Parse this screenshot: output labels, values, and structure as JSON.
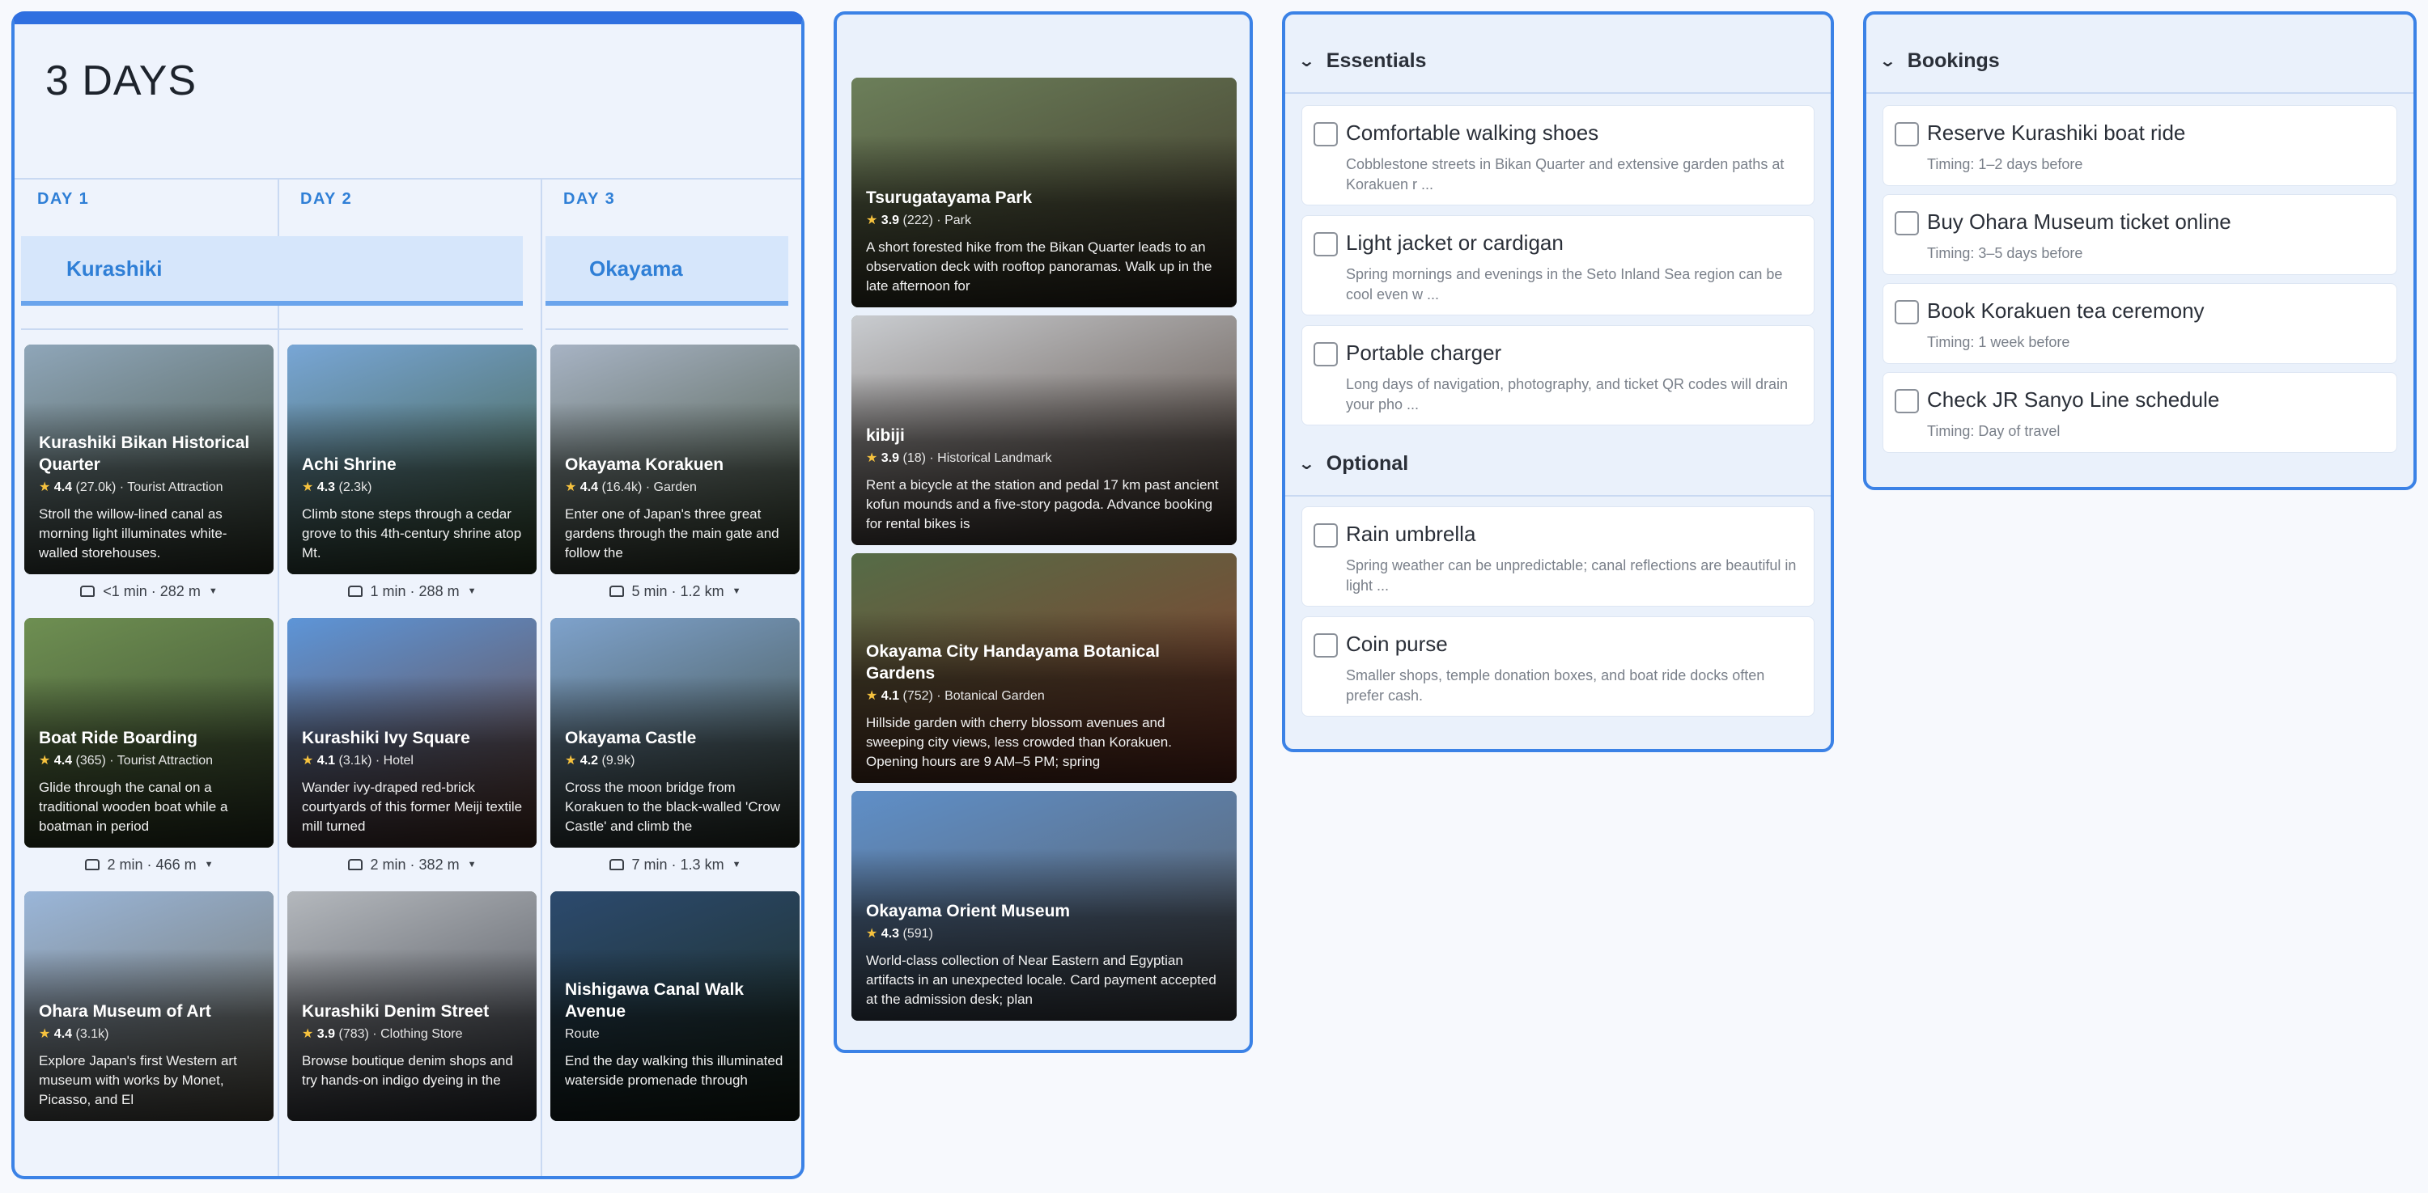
{
  "itinerary": {
    "title": "3 DAYS",
    "days": [
      {
        "label": "DAY 1",
        "base": "Kurashiki"
      },
      {
        "label": "DAY 2",
        "base": ""
      },
      {
        "label": "DAY 3",
        "base": "Okayama"
      }
    ],
    "cards": [
      {
        "name": "Kurashiki Bikan Historical Quarter",
        "rating": "4.4",
        "reviews": "(27.0k)",
        "category": "Tourist Attraction",
        "desc": "Stroll the willow-lined canal as morning light illuminates white-walled storehouses.",
        "c1": "#8fa6b9",
        "c2": "#3f4a38"
      },
      {
        "name": "Achi Shrine",
        "rating": "4.3",
        "reviews": "(2.3k)",
        "category": "",
        "desc": "Climb stone steps through a cedar grove to this 4th-century shrine atop Mt.",
        "c1": "#78a6d6",
        "c2": "#3c5530"
      },
      {
        "name": "Okayama Korakuen",
        "rating": "4.4",
        "reviews": "(16.4k)",
        "category": "Garden",
        "desc": "Enter one of Japan's three great gardens through the main gate and follow the",
        "c1": "#a7b3c4",
        "c2": "#3d4a32"
      },
      {
        "name": "Boat Ride Boarding",
        "rating": "4.4",
        "reviews": "(365)",
        "category": "Tourist Attraction",
        "desc": "Glide through the canal on a traditional wooden boat while a boatman in period",
        "c1": "#6e8f52",
        "c2": "#37452d"
      },
      {
        "name": "Kurashiki Ivy Square",
        "rating": "4.1",
        "reviews": "(3.1k)",
        "category": "Hotel",
        "desc": "Wander ivy-draped red-brick courtyards of this former Meiji textile mill turned",
        "c1": "#5d95d8",
        "c2": "#6b3f30"
      },
      {
        "name": "Okayama Castle",
        "rating": "4.2",
        "reviews": "(9.9k)",
        "category": "",
        "desc": "Cross the moon bridge from Korakuen to the black-walled 'Crow Castle' and climb the",
        "c1": "#7ea2cc",
        "c2": "#3a4436"
      },
      {
        "name": "Ohara Museum of Art",
        "rating": "4.4",
        "reviews": "(3.1k)",
        "category": "",
        "desc": "Explore Japan's first Western art museum with works by Monet, Picasso, and El",
        "c1": "#9ab6d9",
        "c2": "#6f6a5a"
      },
      {
        "name": "Kurashiki Denim Street",
        "rating": "3.9",
        "reviews": "(783)",
        "category": "Clothing Store",
        "desc": "Browse boutique denim shops and try hands-on indigo dyeing in the",
        "c1": "#b4b8bd",
        "c2": "#3d4048"
      },
      {
        "name": "Nishigawa Canal Walk Avenue",
        "rating": "",
        "reviews": "",
        "category": "Route",
        "desc": "End the day walking this illuminated waterside promenade through",
        "c1": "#2c4a6e",
        "c2": "#1b2a1c"
      }
    ],
    "travels": [
      {
        "text": "<1 min · 282 m"
      },
      {
        "text": "1 min · 288 m"
      },
      {
        "text": "5 min · 1.2 km"
      },
      {
        "text": "2 min · 466 m"
      },
      {
        "text": "2 min · 382 m"
      },
      {
        "text": "7 min · 1.3 km"
      }
    ]
  },
  "suggestions": [
    {
      "name": "Tsurugatayama Park",
      "rating": "3.9",
      "reviews": "(222)",
      "category": "Park",
      "desc": "A short forested hike from the Bikan Quarter leads to an observation deck with rooftop panoramas. Walk up in the late afternoon for",
      "c1": "#6c7f5a",
      "c2": "#3b3226"
    },
    {
      "name": "kibiji",
      "rating": "3.9",
      "reviews": "(18)",
      "category": "Historical Landmark",
      "desc": "Rent a bicycle at the station and pedal 17 km past ancient kofun mounds and a five-story pagoda. Advance booking for rental bikes is",
      "c1": "#c9ccd0",
      "c2": "#4a3a30"
    },
    {
      "name": "Okayama City Handayama Botanical Gardens",
      "rating": "4.1",
      "reviews": "(752)",
      "category": "Botanical Garden",
      "desc": "Hillside garden with cherry blossom avenues and sweeping city views, less crowded than Korakuen. Opening hours are 9 AM–5 PM; spring",
      "c1": "#556c47",
      "c2": "#8a3a2a"
    },
    {
      "name": "Okayama Orient Museum",
      "rating": "4.3",
      "reviews": "(591)",
      "category": "",
      "desc": "World-class collection of Near Eastern and Egyptian artifacts in an unexpected locale. Card payment accepted at the admission desk; plan",
      "c1": "#5f8fc8",
      "c2": "#5a5b5e"
    }
  ],
  "packing": {
    "sections": [
      {
        "title": "Essentials",
        "items": [
          {
            "title": "Comfortable walking shoes",
            "note": "Cobblestone streets in Bikan Quarter and extensive garden paths at Korakuen r ..."
          },
          {
            "title": "Light jacket or cardigan",
            "note": "Spring mornings and evenings in the Seto Inland Sea region can be cool even w ..."
          },
          {
            "title": "Portable charger",
            "note": "Long days of navigation, photography, and ticket QR codes will drain your pho ..."
          }
        ]
      },
      {
        "title": "Optional",
        "items": [
          {
            "title": "Rain umbrella",
            "note": "Spring weather can be unpredictable; canal reflections are beautiful in light ..."
          },
          {
            "title": "Coin purse",
            "note": "Smaller shops, temple donation boxes, and boat ride docks often prefer cash."
          }
        ]
      }
    ]
  },
  "bookings": {
    "title": "Bookings",
    "items": [
      {
        "title": "Reserve Kurashiki boat ride",
        "note": "Timing: 1–2 days before"
      },
      {
        "title": "Buy Ohara Museum ticket online",
        "note": "Timing: 3–5 days before"
      },
      {
        "title": "Book Korakuen tea ceremony",
        "note": "Timing: 1 week before"
      },
      {
        "title": "Check JR Sanyo Line schedule",
        "note": "Timing: Day of travel"
      }
    ]
  },
  "icons": {
    "collapse": "chevron-down-icon",
    "travel": "car-icon",
    "rating": "star-icon",
    "expand-travel": "caret-down-icon"
  },
  "colors": {
    "accent": "#2f7fd6",
    "star": "#f6c23e",
    "panel_bg": "#eaf1fb"
  }
}
